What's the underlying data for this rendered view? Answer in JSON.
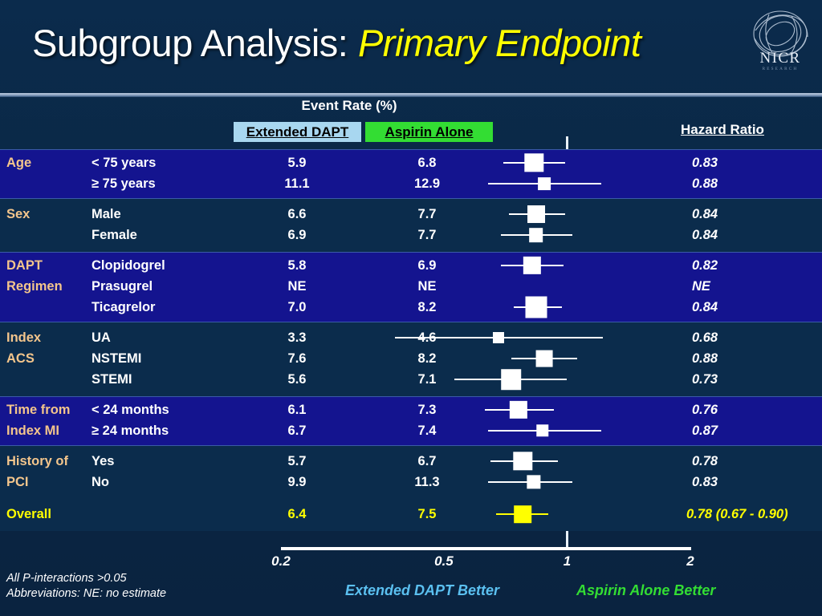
{
  "slide": {
    "title_main": "Subgroup Analysis: ",
    "title_emph": "Primary Endpoint",
    "logo_name": "NICR",
    "background_color": "#0a2744"
  },
  "headers": {
    "event_rate": "Event Rate (%)",
    "arm_a": "Extended DAPT",
    "arm_b": "Aspirin Alone",
    "hazard_ratio": "Hazard Ratio",
    "arm_a_color": "#a8d7f0",
    "arm_b_color": "#33dd33"
  },
  "axis": {
    "ticks": [
      "0.2",
      "0.5",
      "1",
      "2"
    ],
    "tick_values": [
      0.2,
      0.5,
      1,
      2
    ],
    "scale": "log",
    "left_label": "Extended DAPT Better",
    "right_label": "Aspirin Alone Better",
    "left_label_color": "#5bc0f0",
    "right_label_color": "#33dd33"
  },
  "footnotes": [
    "All P-interactions >0.05",
    "Abbreviations: NE: no estimate"
  ],
  "chart_data": {
    "type": "forest",
    "title": "Subgroup Analysis: Primary Endpoint",
    "xlabel": "Hazard Ratio",
    "xlim": [
      0.2,
      2
    ],
    "xscale": "log",
    "xticks": [
      0.2,
      0.5,
      1,
      2
    ],
    "reference_line": 1,
    "columns": [
      "Subgroup",
      "Extended DAPT",
      "Aspirin Alone",
      "Hazard Ratio"
    ],
    "groups": [
      {
        "name": "Age",
        "band": "bright",
        "rows": [
          {
            "label": "< 75 years",
            "rate_a": "5.9",
            "rate_b": "6.8",
            "hr": "0.83",
            "hr_value": 0.83,
            "ci_low": 0.7,
            "ci_high": 0.99,
            "weight": 0.8
          },
          {
            "label": "≥ 75 years",
            "rate_a": "11.1",
            "rate_b": "12.9",
            "hr": "0.88",
            "hr_value": 0.88,
            "ci_low": 0.64,
            "ci_high": 1.21,
            "weight": 0.38
          }
        ]
      },
      {
        "name": "Sex",
        "band": "dark",
        "rows": [
          {
            "label": "Male",
            "rate_a": "6.6",
            "rate_b": "7.7",
            "hr": "0.84",
            "hr_value": 0.84,
            "ci_low": 0.72,
            "ci_high": 0.99,
            "weight": 0.72
          },
          {
            "label": "Female",
            "rate_a": "6.9",
            "rate_b": "7.7",
            "hr": "0.84",
            "hr_value": 0.84,
            "ci_low": 0.69,
            "ci_high": 1.03,
            "weight": 0.48
          }
        ]
      },
      {
        "name": "DAPT Regimen",
        "band": "bright",
        "rows": [
          {
            "label": "Clopidogrel",
            "rate_a": "5.8",
            "rate_b": "6.9",
            "hr": "0.82",
            "hr_value": 0.82,
            "ci_low": 0.69,
            "ci_high": 0.98,
            "weight": 0.74
          },
          {
            "label": "Prasugrel",
            "rate_a": "NE",
            "rate_b": "NE",
            "hr": "NE",
            "hr_value": null,
            "ci_low": null,
            "ci_high": null,
            "weight": 0
          },
          {
            "label": "Ticagrelor",
            "rate_a": "7.0",
            "rate_b": "8.2",
            "hr": "0.84",
            "hr_value": 0.84,
            "ci_low": 0.74,
            "ci_high": 0.97,
            "weight": 1.0
          }
        ]
      },
      {
        "name": "Index ACS",
        "band": "dark",
        "rows": [
          {
            "label": "UA",
            "rate_a": "3.3",
            "rate_b": "4.6",
            "hr": "0.68",
            "hr_value": 0.68,
            "ci_low": 0.38,
            "ci_high": 1.22,
            "weight": 0.28
          },
          {
            "label": "NSTEMI",
            "rate_a": "7.6",
            "rate_b": "8.2",
            "hr": "0.88",
            "hr_value": 0.88,
            "ci_low": 0.73,
            "ci_high": 1.06,
            "weight": 0.66
          },
          {
            "label": "STEMI",
            "rate_a": "5.6",
            "rate_b": "7.1",
            "hr": "0.73",
            "hr_value": 0.73,
            "ci_low": 0.53,
            "ci_high": 1.0,
            "weight": 0.92
          }
        ]
      },
      {
        "name": "Time from Index MI",
        "band": "bright",
        "rows": [
          {
            "label": "< 24 months",
            "rate_a": "6.1",
            "rate_b": "7.3",
            "hr": "0.76",
            "hr_value": 0.76,
            "ci_low": 0.63,
            "ci_high": 0.93,
            "weight": 0.74
          },
          {
            "label": "≥ 24 months",
            "rate_a": "6.7",
            "rate_b": "7.4",
            "hr": "0.87",
            "hr_value": 0.87,
            "ci_low": 0.64,
            "ci_high": 1.21,
            "weight": 0.36
          }
        ]
      },
      {
        "name": "History of PCI",
        "band": "dark",
        "rows": [
          {
            "label": "Yes",
            "rate_a": "5.7",
            "rate_b": "6.7",
            "hr": "0.78",
            "hr_value": 0.78,
            "ci_low": 0.65,
            "ci_high": 0.95,
            "weight": 0.8
          },
          {
            "label": "No",
            "rate_a": "9.9",
            "rate_b": "11.3",
            "hr": "0.83",
            "hr_value": 0.83,
            "ci_low": 0.64,
            "ci_high": 1.03,
            "weight": 0.46
          }
        ]
      },
      {
        "name": "Overall",
        "band": "last",
        "highlight_color": "#ffff00",
        "rows": [
          {
            "label": "",
            "rate_a": "6.4",
            "rate_b": "7.5",
            "hr": "0.78 (0.67 - 0.90)",
            "hr_value": 0.78,
            "ci_low": 0.67,
            "ci_high": 0.9,
            "weight": 0.7,
            "highlight": true
          }
        ]
      }
    ]
  }
}
